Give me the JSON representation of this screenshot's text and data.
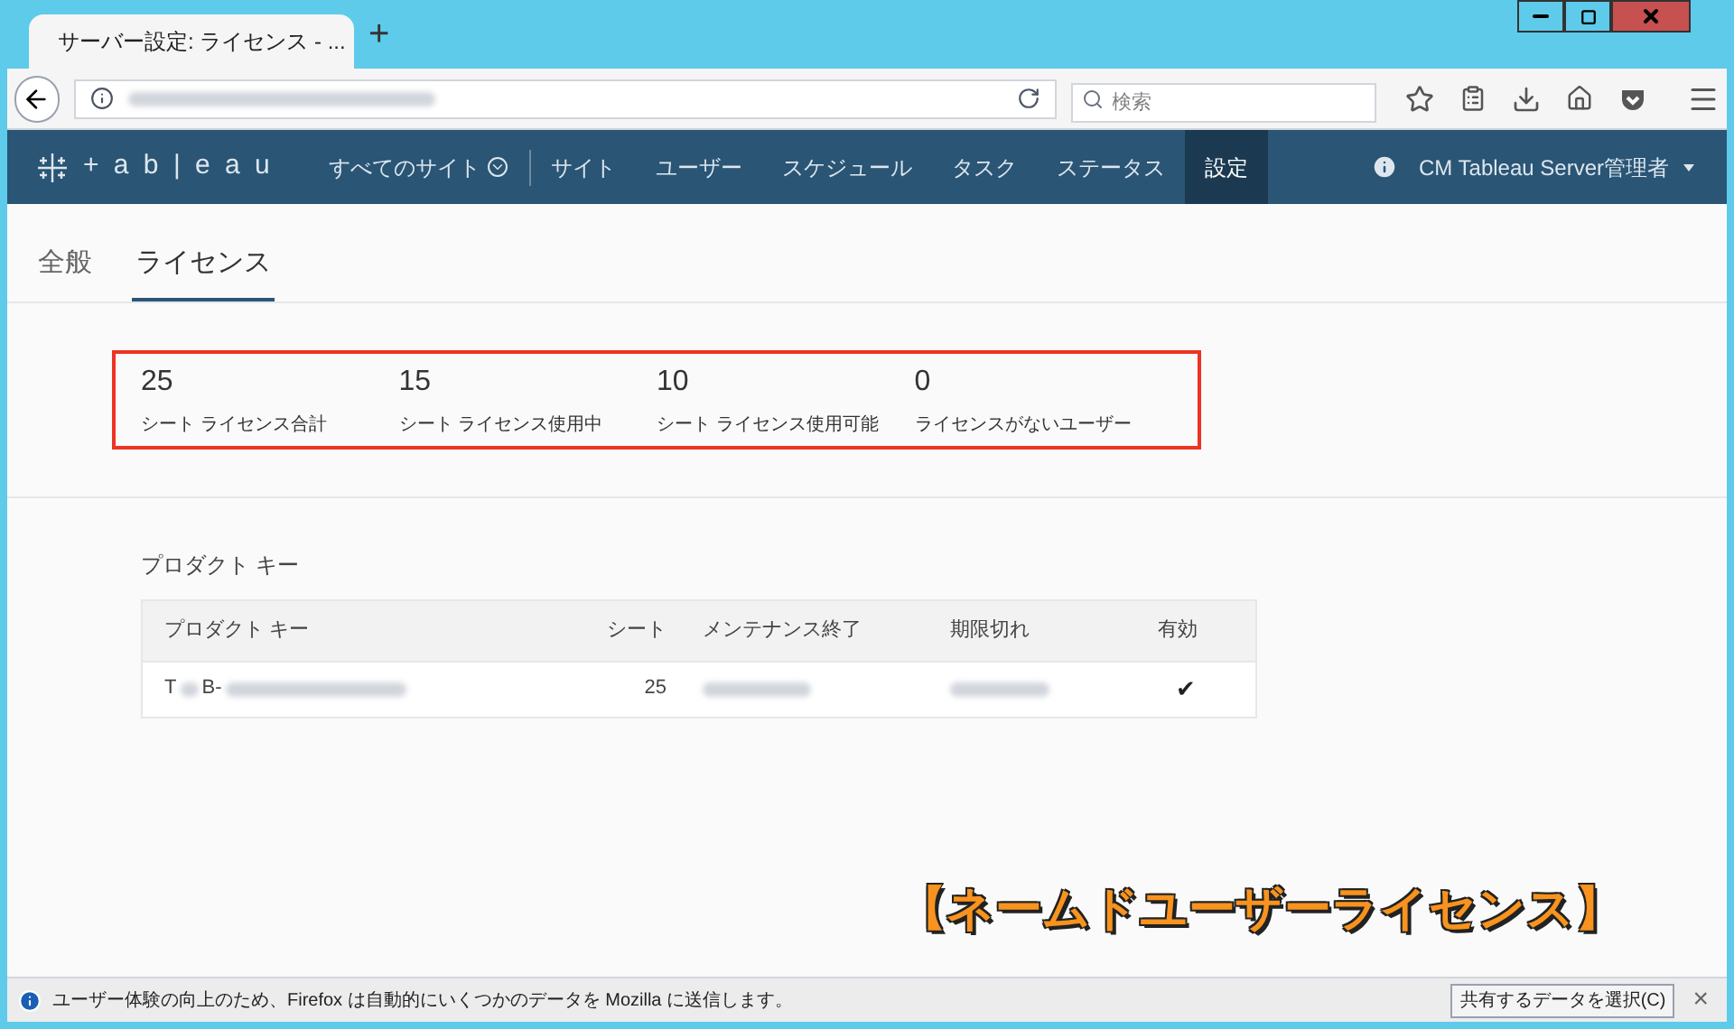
{
  "browser": {
    "tab_title": "サーバー設定: ライセンス - ...",
    "new_tab": "+",
    "search_placeholder": "検索"
  },
  "nav": {
    "logo": "+ a b | e a u",
    "site_switch": "すべてのサイト",
    "items": [
      {
        "label": "サイト",
        "selected": false
      },
      {
        "label": "ユーザー",
        "selected": false
      },
      {
        "label": "スケジュール",
        "selected": false
      },
      {
        "label": "タスク",
        "selected": false
      },
      {
        "label": "ステータス",
        "selected": false
      },
      {
        "label": "設定",
        "selected": true
      }
    ],
    "user": "CM Tableau Server管理者"
  },
  "tabs": [
    {
      "label": "全般",
      "selected": false
    },
    {
      "label": "ライセンス",
      "selected": true
    }
  ],
  "stats": [
    {
      "value": "25",
      "label": "シート ライセンス合計"
    },
    {
      "value": "15",
      "label": "シート ライセンス使用中"
    },
    {
      "value": "10",
      "label": "シート ライセンス使用可能"
    },
    {
      "value": "0",
      "label": "ライセンスがないユーザー"
    }
  ],
  "table": {
    "title": "プロダクト キー",
    "columns": [
      "プロダクト キー",
      "シート",
      "メンテナンス終了",
      "期限切れ",
      "有効"
    ],
    "rows": [
      {
        "key_prefix": "T",
        "key_mid": "B-",
        "seats": "25",
        "valid": true,
        "valid_mark": "✔"
      }
    ]
  },
  "caption": "【ネームドユーザーライセンス】",
  "notification": {
    "text": "ユーザー体験の向上のため、Firefox は自動的にいくつかのデータを Mozilla に送信します。",
    "button": "共有するデータを選択(C)",
    "close": "×"
  }
}
